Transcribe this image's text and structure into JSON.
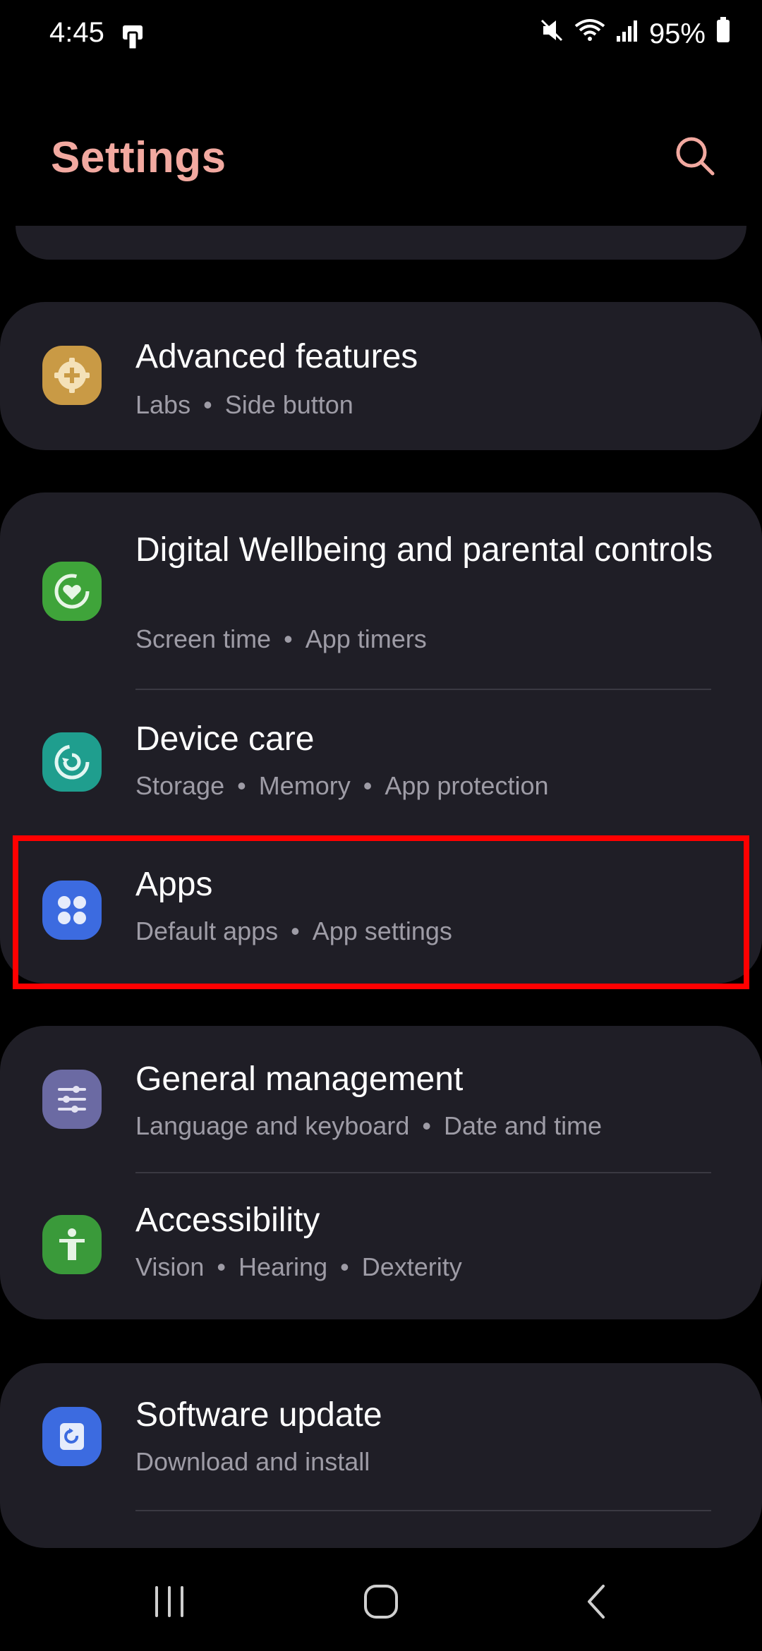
{
  "status": {
    "time": "4:45",
    "battery": "95%",
    "icons": [
      "screen-mirror-icon",
      "mute-icon",
      "wifi-icon",
      "signal-icon",
      "battery-icon"
    ]
  },
  "header": {
    "title": "Settings",
    "search_icon": "search-icon"
  },
  "items": {
    "advanced": {
      "title": "Advanced features",
      "sub1": "Labs",
      "sub2": "Side button",
      "icon": "gear-plus-icon",
      "color": "#c99a45"
    },
    "wellbeing": {
      "title": "Digital Wellbeing and parental controls",
      "sub1": "Screen time",
      "sub2": "App timers",
      "icon": "wellbeing-heart-icon",
      "color": "#3fa43a"
    },
    "devicecare": {
      "title": "Device care",
      "sub1": "Storage",
      "sub2": "Memory",
      "sub3": "App protection",
      "icon": "device-care-icon",
      "color": "#1f9e8e"
    },
    "apps": {
      "title": "Apps",
      "sub1": "Default apps",
      "sub2": "App settings",
      "icon": "apps-grid-icon",
      "color": "#3c6be0"
    },
    "general": {
      "title": "General management",
      "sub1": "Language and keyboard",
      "sub2": "Date and time",
      "icon": "sliders-icon",
      "color": "#6b6aa3"
    },
    "accessibility": {
      "title": "Accessibility",
      "sub1": "Vision",
      "sub2": "Hearing",
      "sub3": "Dexterity",
      "icon": "accessibility-person-icon",
      "color": "#3a9a3a"
    },
    "software": {
      "title": "Software update",
      "sub1": "Download and install",
      "icon": "software-update-icon",
      "color": "#3c6be0"
    }
  },
  "nav": {
    "icons": [
      "recent-apps-icon",
      "home-icon",
      "back-icon"
    ]
  }
}
